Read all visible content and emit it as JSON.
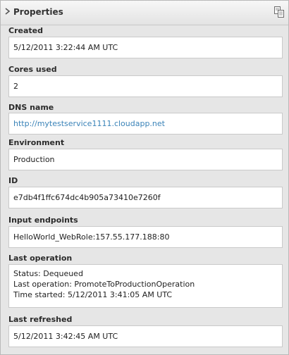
{
  "header": {
    "title": "Properties"
  },
  "properties": {
    "created": {
      "label": "Created",
      "value": "5/12/2011 3:22:44 AM UTC"
    },
    "cores_used": {
      "label": "Cores used",
      "value": "2"
    },
    "dns_name": {
      "label": "DNS name",
      "value": "http://mytestservice1111.cloudapp.net"
    },
    "environment": {
      "label": "Environment",
      "value": "Production"
    },
    "id": {
      "label": "ID",
      "value": "e7db4f1ffc674dc4b905a73410e7260f"
    },
    "input_endpoints": {
      "label": "Input endpoints",
      "value": "HelloWorld_WebRole:157.55.177.188:80"
    },
    "last_operation": {
      "label": "Last operation",
      "lines": [
        "Status: Dequeued",
        "Last operation: PromoteToProductionOperation",
        "Time started: 5/12/2011 3:41:05 AM UTC"
      ]
    },
    "last_refreshed": {
      "label": "Last refreshed",
      "value": "5/12/2011 3:42:45 AM UTC"
    }
  },
  "colors": {
    "link": "#3a83b8",
    "panel_bg": "#e6e6e6",
    "value_bg": "#ffffff"
  },
  "icons": {
    "header_left": "chevron-right-icon",
    "header_right": "copy-icon"
  }
}
